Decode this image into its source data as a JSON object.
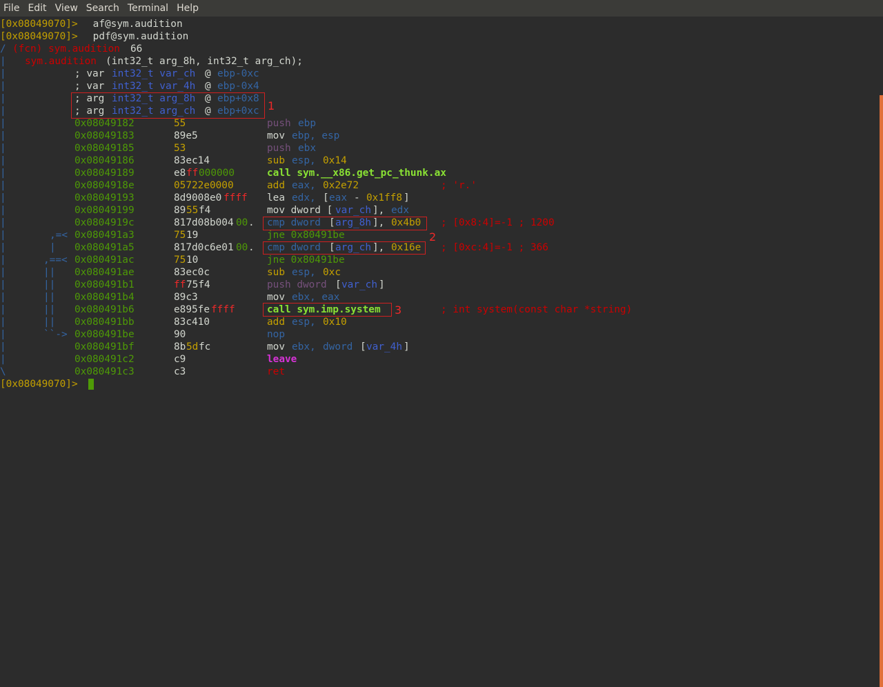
{
  "menu": [
    "File",
    "Edit",
    "View",
    "Search",
    "Terminal",
    "Help"
  ],
  "colors": {
    "prompt": "#c4a000",
    "fg": "#d3d7cf",
    "bar": "#3465a4",
    "addr": "#4e9a06",
    "func": "#cc0000",
    "blue": "#3465a4",
    "bright_green": "#8ae234",
    "purple": "#75507b",
    "magenta": "#ad7fa8",
    "comment": "#cc0000",
    "bytes_ff": "#ef2929",
    "bytes_00": "#4e9a06",
    "yellow": "#c4a000",
    "bright_magenta": "#d633d6",
    "bright_blue": "#4060d0",
    "flow": "#3465a4",
    "scrollbar": "#e0703a",
    "annotation": "#d02020"
  },
  "lines": [
    [
      [
        0,
        "[0x08049070]>",
        "prompt"
      ],
      [
        14,
        " af@sym.audition",
        "fg"
      ]
    ],
    [
      [
        0,
        "[0x08049070]>",
        "prompt"
      ],
      [
        14,
        " pdf@sym.audition",
        "fg"
      ]
    ],
    [
      [
        0,
        "/",
        "bar"
      ],
      [
        2,
        "(fcn) sym.audition",
        "func"
      ],
      [
        21,
        "66",
        "fg"
      ]
    ],
    [
      [
        0,
        "|",
        "bar"
      ],
      [
        4,
        "sym.audition",
        "func"
      ],
      [
        17,
        "(int32_t arg_8h, int32_t arg_ch);",
        "fg"
      ]
    ],
    [
      [
        0,
        "|",
        "bar"
      ],
      [
        12,
        "; var",
        "fg"
      ],
      [
        18,
        "int32_t var_ch",
        "bright_blue"
      ],
      [
        33,
        "@",
        "fg"
      ],
      [
        35,
        "ebp-0xc",
        "blue"
      ]
    ],
    [
      [
        0,
        "|",
        "bar"
      ],
      [
        12,
        "; var",
        "fg"
      ],
      [
        18,
        "int32_t var_4h",
        "bright_blue"
      ],
      [
        33,
        "@",
        "fg"
      ],
      [
        35,
        "ebp-0x4",
        "blue"
      ]
    ],
    [
      [
        0,
        "|",
        "bar"
      ],
      [
        12,
        "; arg",
        "fg"
      ],
      [
        18,
        "int32_t arg_8h",
        "bright_blue"
      ],
      [
        33,
        "@",
        "fg"
      ],
      [
        35,
        "ebp+0x8",
        "blue"
      ]
    ],
    [
      [
        0,
        "|",
        "bar"
      ],
      [
        12,
        "; arg",
        "fg"
      ],
      [
        18,
        "int32_t arg_ch",
        "bright_blue"
      ],
      [
        33,
        "@",
        "fg"
      ],
      [
        35,
        "ebp+0xc",
        "blue"
      ]
    ],
    [
      [
        0,
        "|",
        "bar"
      ],
      [
        12,
        "0x08049182",
        "addr"
      ],
      [
        28,
        "55",
        "yellow"
      ],
      [
        43,
        "push",
        "purple"
      ],
      [
        48,
        "ebp",
        "blue"
      ]
    ],
    [
      [
        0,
        "|",
        "bar"
      ],
      [
        12,
        "0x08049183",
        "addr"
      ],
      [
        28,
        "89e5",
        "fg"
      ],
      [
        43,
        "mov",
        "fg"
      ],
      [
        47,
        "ebp, esp",
        "blue"
      ]
    ],
    [
      [
        0,
        "|",
        "bar"
      ],
      [
        12,
        "0x08049185",
        "addr"
      ],
      [
        28,
        "53",
        "yellow"
      ],
      [
        43,
        "push",
        "purple"
      ],
      [
        48,
        "ebx",
        "blue"
      ]
    ],
    [
      [
        0,
        "|",
        "bar"
      ],
      [
        12,
        "0x08049186",
        "addr"
      ],
      [
        28,
        "83ec14",
        "fg"
      ],
      [
        43,
        "sub",
        "yellow"
      ],
      [
        47,
        "esp,",
        "blue"
      ],
      [
        52,
        "0x14",
        "yellow"
      ]
    ],
    [
      [
        0,
        "|",
        "bar"
      ],
      [
        12,
        "0x08049189",
        "addr"
      ],
      [
        28,
        "e8",
        "fg"
      ],
      [
        30,
        "ff",
        "bytes_ff"
      ],
      [
        32,
        "000000",
        "bytes_00"
      ],
      [
        43,
        "call sym.__x86.get_pc_thunk.ax",
        "bright_green"
      ]
    ],
    [
      [
        0,
        "|",
        "bar"
      ],
      [
        12,
        "0x0804918e",
        "addr"
      ],
      [
        28,
        "05722e0000",
        "yellow"
      ],
      [
        43,
        "add",
        "yellow"
      ],
      [
        47,
        "eax,",
        "blue"
      ],
      [
        52,
        "0x2e72",
        "yellow"
      ],
      [
        71,
        "; 'r.'",
        "comment"
      ]
    ],
    [
      [
        0,
        "|",
        "bar"
      ],
      [
        12,
        "0x08049193",
        "addr"
      ],
      [
        28,
        "8d9008e0",
        "fg"
      ],
      [
        36,
        "ffff",
        "bytes_ff"
      ],
      [
        43,
        "lea",
        "fg"
      ],
      [
        47,
        "edx,",
        "blue"
      ],
      [
        52,
        "[",
        "fg"
      ],
      [
        53,
        "eax",
        "blue"
      ],
      [
        57,
        "-",
        "fg"
      ],
      [
        59,
        "0x1ff8",
        "yellow"
      ],
      [
        65,
        "]",
        "fg"
      ]
    ],
    [
      [
        0,
        "|",
        "bar"
      ],
      [
        12,
        "0x08049199",
        "addr"
      ],
      [
        28,
        "89",
        "fg"
      ],
      [
        30,
        "55",
        "yellow"
      ],
      [
        32,
        "f4",
        "fg"
      ],
      [
        43,
        "mov dword [",
        "fg"
      ],
      [
        54,
        "var_ch",
        "bright_blue"
      ],
      [
        60,
        "],",
        "fg"
      ],
      [
        63,
        "edx",
        "blue"
      ]
    ],
    [
      [
        0,
        "|",
        "bar"
      ],
      [
        12,
        "0x0804919c",
        "addr"
      ],
      [
        28,
        "817d08b004",
        "fg"
      ],
      [
        38,
        "00",
        "bytes_00"
      ],
      [
        40,
        ".",
        "fg"
      ],
      [
        43,
        "cmp dword",
        "blue"
      ],
      [
        53,
        "[",
        "fg"
      ],
      [
        54,
        "arg_8h",
        "bright_blue"
      ],
      [
        60,
        "],",
        "fg"
      ],
      [
        63,
        "0x4b0",
        "yellow"
      ],
      [
        71,
        "; [0x8:4]=-1 ; 1200",
        "comment"
      ]
    ],
    [
      [
        0,
        "|",
        "bar"
      ],
      [
        8,
        ",=<",
        "flow"
      ],
      [
        12,
        "0x080491a3",
        "addr"
      ],
      [
        28,
        "75",
        "yellow"
      ],
      [
        30,
        "19",
        "fg"
      ],
      [
        43,
        "jne 0x80491be",
        "addr"
      ]
    ],
    [
      [
        0,
        "|",
        "bar"
      ],
      [
        8,
        "|",
        "flow"
      ],
      [
        12,
        "0x080491a5",
        "addr"
      ],
      [
        28,
        "817d0c6e01",
        "fg"
      ],
      [
        38,
        "00",
        "bytes_00"
      ],
      [
        40,
        ".",
        "fg"
      ],
      [
        43,
        "cmp dword",
        "blue"
      ],
      [
        53,
        "[",
        "fg"
      ],
      [
        54,
        "arg_ch",
        "bright_blue"
      ],
      [
        60,
        "],",
        "fg"
      ],
      [
        63,
        "0x16e",
        "yellow"
      ],
      [
        71,
        "; [0xc:4]=-1 ; 366",
        "comment"
      ]
    ],
    [
      [
        0,
        "|",
        "bar"
      ],
      [
        7,
        ",==<",
        "flow"
      ],
      [
        12,
        "0x080491ac",
        "addr"
      ],
      [
        28,
        "75",
        "yellow"
      ],
      [
        30,
        "10",
        "fg"
      ],
      [
        43,
        "jne 0x80491be",
        "addr"
      ]
    ],
    [
      [
        0,
        "|",
        "bar"
      ],
      [
        7,
        "||",
        "flow"
      ],
      [
        12,
        "0x080491ae",
        "addr"
      ],
      [
        28,
        "83ec0c",
        "fg"
      ],
      [
        43,
        "sub",
        "yellow"
      ],
      [
        47,
        "esp,",
        "blue"
      ],
      [
        52,
        "0xc",
        "yellow"
      ]
    ],
    [
      [
        0,
        "|",
        "bar"
      ],
      [
        7,
        "||",
        "flow"
      ],
      [
        12,
        "0x080491b1",
        "addr"
      ],
      [
        28,
        "ff",
        "bytes_ff"
      ],
      [
        30,
        "75f4",
        "fg"
      ],
      [
        43,
        "push dword",
        "purple"
      ],
      [
        54,
        "[",
        "fg"
      ],
      [
        55,
        "var_ch",
        "bright_blue"
      ],
      [
        61,
        "]",
        "fg"
      ]
    ],
    [
      [
        0,
        "|",
        "bar"
      ],
      [
        7,
        "||",
        "flow"
      ],
      [
        12,
        "0x080491b4",
        "addr"
      ],
      [
        28,
        "89c3",
        "fg"
      ],
      [
        43,
        "mov",
        "fg"
      ],
      [
        47,
        "ebx, eax",
        "blue"
      ]
    ],
    [
      [
        0,
        "|",
        "bar"
      ],
      [
        7,
        "||",
        "flow"
      ],
      [
        12,
        "0x080491b6",
        "addr"
      ],
      [
        28,
        "e895fe",
        "fg"
      ],
      [
        34,
        "ffff",
        "bytes_ff"
      ],
      [
        43,
        "call sym.imp.system",
        "bright_green"
      ],
      [
        71,
        "; int system(const char *string)",
        "comment"
      ]
    ],
    [
      [
        0,
        "|",
        "bar"
      ],
      [
        7,
        "||",
        "flow"
      ],
      [
        12,
        "0x080491bb",
        "addr"
      ],
      [
        28,
        "83c410",
        "fg"
      ],
      [
        43,
        "add",
        "yellow"
      ],
      [
        47,
        "esp,",
        "blue"
      ],
      [
        52,
        "0x10",
        "yellow"
      ]
    ],
    [
      [
        0,
        "|",
        "bar"
      ],
      [
        7,
        "``->",
        "flow"
      ],
      [
        12,
        "0x080491be",
        "addr"
      ],
      [
        28,
        "90",
        "fg"
      ],
      [
        43,
        "nop",
        "blue"
      ]
    ],
    [
      [
        0,
        "|",
        "bar"
      ],
      [
        12,
        "0x080491bf",
        "addr"
      ],
      [
        28,
        "8b",
        "fg"
      ],
      [
        30,
        "5d",
        "yellow"
      ],
      [
        32,
        "fc",
        "fg"
      ],
      [
        43,
        "mov",
        "fg"
      ],
      [
        47,
        "ebx,",
        "blue"
      ],
      [
        52,
        "dword",
        "blue"
      ],
      [
        58,
        "[",
        "fg"
      ],
      [
        59,
        "var_4h",
        "bright_blue"
      ],
      [
        65,
        "]",
        "fg"
      ]
    ],
    [
      [
        0,
        "|",
        "bar"
      ],
      [
        12,
        "0x080491c2",
        "addr"
      ],
      [
        28,
        "c9",
        "fg"
      ],
      [
        43,
        "leave",
        "bright_magenta"
      ]
    ],
    [
      [
        0,
        "\\",
        "bar"
      ],
      [
        12,
        "0x080491c3",
        "addr"
      ],
      [
        28,
        "c3",
        "fg"
      ],
      [
        43,
        "ret",
        "func"
      ]
    ],
    [
      [
        0,
        "[0x08049070]>",
        "prompt"
      ]
    ]
  ],
  "annotations": [
    "1",
    "2",
    "3"
  ]
}
